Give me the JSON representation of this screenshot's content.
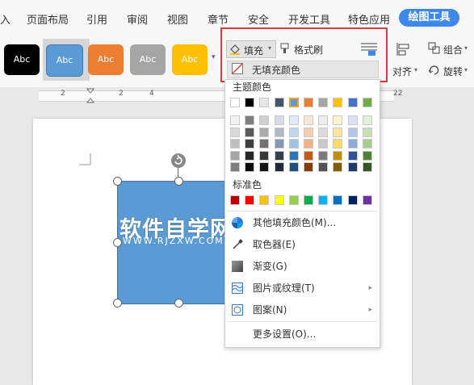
{
  "menubar": {
    "items": [
      "入",
      "页面布局",
      "引用",
      "审阅",
      "视图",
      "章节",
      "安全",
      "开发工具",
      "特色应用"
    ],
    "active_tab": "绘图工具"
  },
  "ribbon": {
    "style_swatches": [
      {
        "label": "Abc",
        "color": "#000000"
      },
      {
        "label": "Abc",
        "color": "#5b9bd5"
      },
      {
        "label": "Abc",
        "color": "#ed7d31"
      },
      {
        "label": "Abc",
        "color": "#a5a5a5"
      },
      {
        "label": "Abc",
        "color": "#ffc000"
      }
    ],
    "fill_label": "填充",
    "format_painter_label": "格式刷",
    "group_label": "组合",
    "align_label": "对齐",
    "rotate_label": "旋转"
  },
  "ruler": {
    "ticks": [
      "2",
      "2",
      "4",
      "22"
    ]
  },
  "watermark": {
    "main": "软件自学网",
    "sub": "WWW.RJZXW.COM"
  },
  "dropdown": {
    "no_fill": "无填充颜色",
    "theme_colors_title": "主题颜色",
    "theme_top": [
      "#ffffff",
      "#000000",
      "#e7e6e6",
      "#44546a",
      "#5b9bd5",
      "#ed7d31",
      "#a5a5a5",
      "#ffc000",
      "#4472c4",
      "#70ad47"
    ],
    "theme_shades": [
      [
        "#f2f2f2",
        "#7f7f7f",
        "#d0cece",
        "#d6dce4",
        "#deebf6",
        "#fbe5d5",
        "#ededed",
        "#fff2cc",
        "#dae3f3",
        "#e2efd9"
      ],
      [
        "#d8d8d8",
        "#595959",
        "#aeabab",
        "#adb9ca",
        "#bdd7ee",
        "#f8cbad",
        "#dbdbdb",
        "#fee599",
        "#b4c6e7",
        "#c5e0b3"
      ],
      [
        "#bfbfbf",
        "#3f3f3f",
        "#757070",
        "#8496b0",
        "#9dc3e6",
        "#f4b183",
        "#c9c9c9",
        "#ffd965",
        "#8eaadb",
        "#a8d08d"
      ],
      [
        "#a5a5a5",
        "#262626",
        "#3a3838",
        "#323f4f",
        "#2e75b5",
        "#c55a11",
        "#7b7b7b",
        "#bf9000",
        "#2f5496",
        "#538135"
      ],
      [
        "#7f7f7f",
        "#0c0c0c",
        "#171616",
        "#222a35",
        "#1e4e79",
        "#833c0b",
        "#525252",
        "#7f6000",
        "#1f3864",
        "#375623"
      ]
    ],
    "standard_title": "标准色",
    "standard_colors": [
      "#c00000",
      "#ff0000",
      "#ffc000",
      "#ffff00",
      "#92d050",
      "#00b050",
      "#00b0f0",
      "#0070c0",
      "#002060",
      "#7030a0"
    ],
    "items": [
      {
        "label": "其他填充颜色(M)...",
        "icon": "color-wheel-icon",
        "submenu": false
      },
      {
        "label": "取色器(E)",
        "icon": "eyedropper-icon",
        "submenu": false
      },
      {
        "label": "渐变(G)",
        "icon": "gradient-icon",
        "submenu": true
      },
      {
        "label": "图片或纹理(T)",
        "icon": "texture-icon",
        "submenu": true
      },
      {
        "label": "图案(N)",
        "icon": "pattern-icon",
        "submenu": true
      },
      {
        "label": "更多设置(O)...",
        "icon": "",
        "submenu": false
      }
    ]
  }
}
